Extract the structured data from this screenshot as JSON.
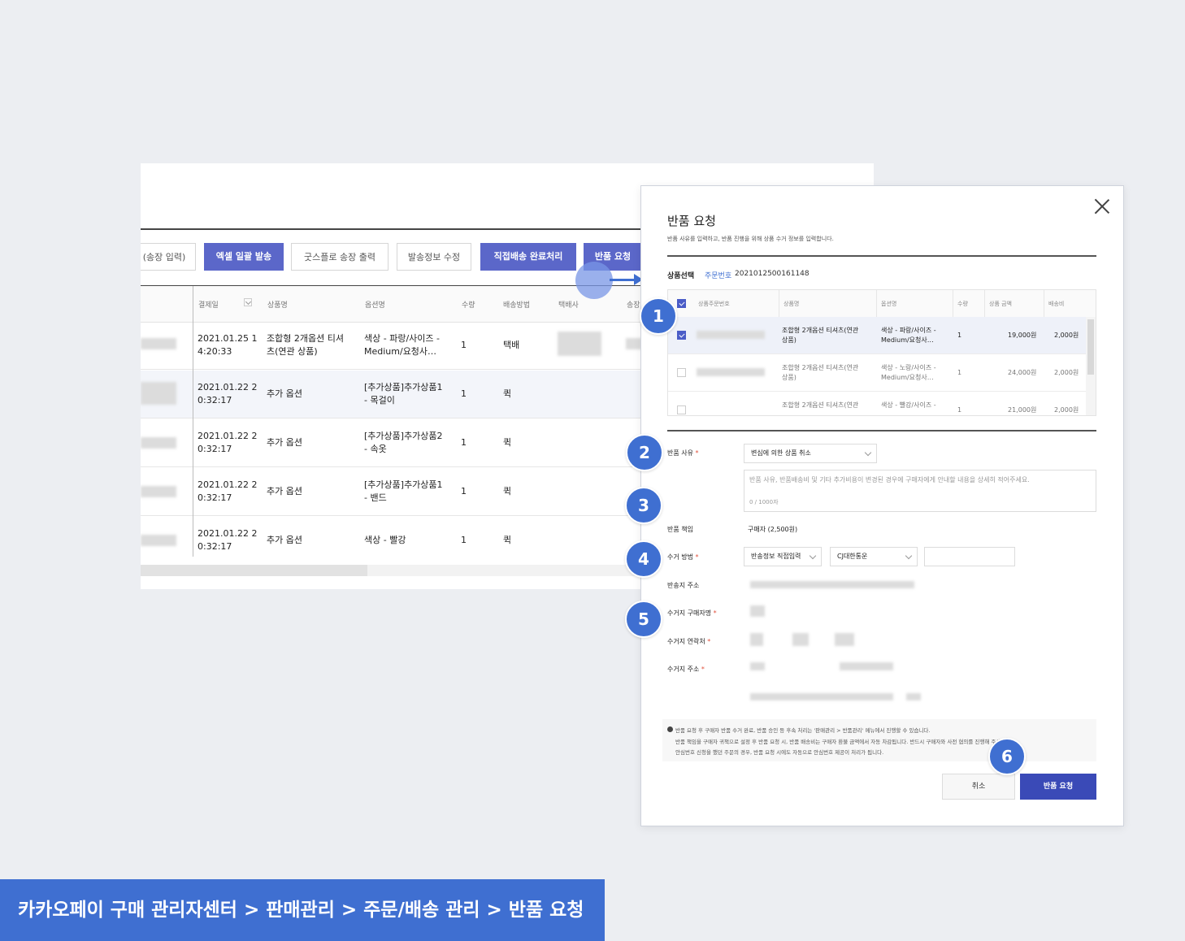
{
  "toolbar": {
    "invoice_input": "(송장 입력)",
    "excel_bulk_ship": "엑셀 일괄 발송",
    "goodsflow_print": "굿스플로 송장 출력",
    "edit_shipping": "발송정보 수정",
    "direct_delivery_done": "직접배송 완료처리",
    "return_request": "반품 요청"
  },
  "order_table": {
    "headers": [
      "결제일",
      "상품명",
      "옵션명",
      "수량",
      "배송방법",
      "택배사",
      "송장"
    ],
    "rows": [
      {
        "date1": "2021.01.25 1",
        "date2": "4:20:33",
        "product1": "조합형 2개옵션 티셔",
        "product2": "츠(연관 상품)",
        "option1": "색상 - 파랑/사이즈 -",
        "option2": "Medium/요청사…",
        "qty": "1",
        "method": "택배"
      },
      {
        "date1": "2021.01.22 2",
        "date2": "0:32:17",
        "product1": "추가 옵션",
        "product2": "",
        "option1": "[추가상품]추가상품1",
        "option2": "- 목걸이",
        "qty": "1",
        "method": "퀵"
      },
      {
        "date1": "2021.01.22 2",
        "date2": "0:32:17",
        "product1": "추가 옵션",
        "product2": "",
        "option1": "[추가상품]추가상품2",
        "option2": "- 속옷",
        "qty": "1",
        "method": "퀵"
      },
      {
        "date1": "2021.01.22 2",
        "date2": "0:32:17",
        "product1": "추가 옵션",
        "product2": "",
        "option1": "[추가상품]추가상품1",
        "option2": "- 밴드",
        "qty": "1",
        "method": "퀵"
      },
      {
        "date1": "2021.01.22 2",
        "date2": "0:32:17",
        "product1": "추가 옵션",
        "product2": "",
        "option1": "색상 - 빨강",
        "option2": "",
        "qty": "1",
        "method": "퀵"
      }
    ]
  },
  "modal": {
    "title": "반품 요청",
    "description": "반품 사유를 입력하고, 반품 진행을 위해 상품 수거 정보를 입력합니다.",
    "product_select_label": "상품선택",
    "order_no_label": "주문번호",
    "order_no": "2021012500161148",
    "item_headers": [
      "상품주문번호",
      "상품명",
      "옵션명",
      "수량",
      "상품 금액",
      "배송비"
    ],
    "items": [
      {
        "name1": "조합형 2개옵션 티셔츠(연관",
        "name2": "상품)",
        "opt1": "색상 - 파랑/사이즈 -",
        "opt2": "Medium/요청사…",
        "qty": "1",
        "price": "19,000원",
        "ship": "2,000원"
      },
      {
        "name1": "조합형 2개옵션 티셔츠(연관",
        "name2": "상품)",
        "opt1": "색상 - 노랑/사이즈 -",
        "opt2": "Medium/요청사…",
        "qty": "1",
        "price": "24,000원",
        "ship": "2,000원"
      },
      {
        "name1": "조합형 2개옵션 티셔츠(연관",
        "name2": "",
        "opt1": "색상 - 빨강/사이즈 -",
        "opt2": "",
        "qty": "1",
        "price": "21,000원",
        "ship": "2,000원"
      }
    ],
    "reason_label": "반품 사유",
    "reason_value": "변심에 의한 상품 취소",
    "reason_placeholder": "반품 사유, 반품배송비 및 기타 추가비용이 변경된 경우에 구매자에게 안내할 내용을 상세히 적어주세요.",
    "reason_count": "0 / 1000자",
    "responsibility_label": "반품 책임",
    "responsibility_value": "구매자 (2,500원)",
    "pickup_method_label": "수거 방법",
    "pickup_method_value": "반송정보 직접입력",
    "courier_value": "CJ대한통운",
    "return_address_label": "반송지 주소",
    "pickup_name_label": "수거지 구매자명",
    "pickup_phone_label": "수거지 연락처",
    "pickup_address_label": "수거지 주소",
    "notice1": "반품 요청 후 구매자 반품 수거 완료, 반품 승인 등 후속 처리는 '판매관리 > 반품관리' 메뉴에서 진행할 수 있습니다.",
    "notice2": "반품 책임을 구매자 귀책으로 설정 후 반품 요청 시, 반품 배송비는 구매자 환불 금액에서 자동 차감됩니다. 반드시 구매자와 사전 협의를 진행해 주세요.",
    "notice3": "안심번호 신청을 했던 주문의 경우, 반품 요청 시에도 자동으로 안심번호 제공이 처리가 됩니다.",
    "cancel_label": "취소",
    "submit_label": "반품 요청"
  },
  "badges": [
    "1",
    "2",
    "3",
    "4",
    "5",
    "6"
  ],
  "caption": "카카오페이 구매 관리자센터 > 판매관리 > 주문/배송 관리 > 반품 요청",
  "colors": {
    "accent": "#3f6fd1",
    "primary_button": "#5b67c9",
    "submit_button": "#3a4ab7"
  }
}
